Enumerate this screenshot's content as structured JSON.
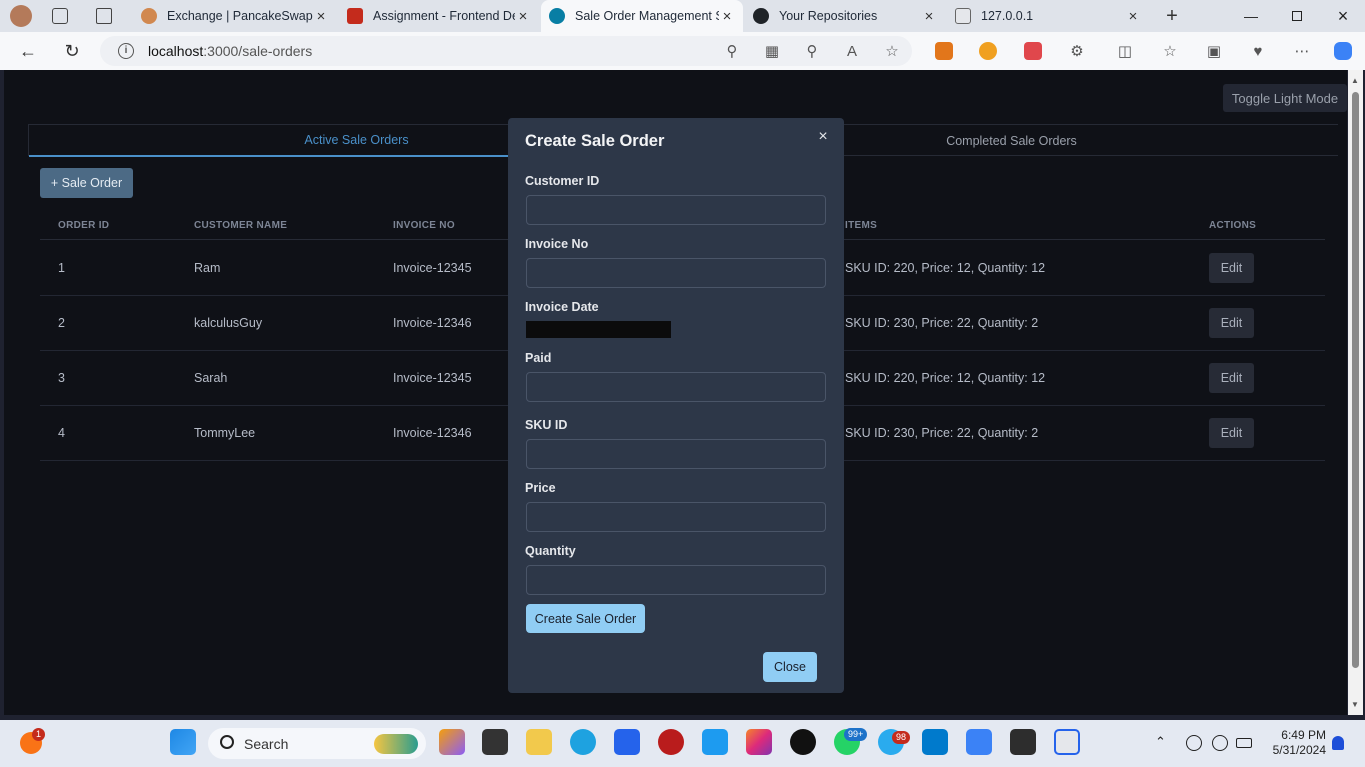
{
  "browser": {
    "tabs": [
      {
        "title": "Exchange | PancakeSwap",
        "icon": "pancakeswap-icon",
        "color": "#d1884f"
      },
      {
        "title": "Assignment - Frontend De",
        "icon": "pdf-icon",
        "color": "#c42b1c"
      },
      {
        "title": "Sale Order Management S",
        "icon": "react-icon",
        "color": "#087ea4"
      },
      {
        "title": "Your Repositories",
        "icon": "github-icon",
        "color": "#1f2328"
      },
      {
        "title": "127.0.0.1",
        "icon": "page-icon",
        "color": "#666666"
      }
    ],
    "url_host": "localhost",
    "url_path": ":3000/sale-orders"
  },
  "page": {
    "toggle_label": "Toggle Light Mode",
    "tabs": [
      "Active Sale Orders",
      "Completed Sale Orders"
    ],
    "add_button": "+ Sale Order",
    "columns": [
      "ORDER ID",
      "CUSTOMER NAME",
      "INVOICE NO",
      "ITEMS",
      "ACTIONS"
    ],
    "rows": [
      {
        "id": "1",
        "name": "Ram",
        "invoice": "Invoice-12345",
        "items": "SKU ID: 220, Price: 12, Quantity: 12",
        "action": "Edit"
      },
      {
        "id": "2",
        "name": "kalculusGuy",
        "invoice": "Invoice-12346",
        "items": "SKU ID: 230, Price: 22, Quantity: 2",
        "action": "Edit"
      },
      {
        "id": "3",
        "name": "Sarah",
        "invoice": "Invoice-12345",
        "items": "SKU ID: 220, Price: 12, Quantity: 12",
        "action": "Edit"
      },
      {
        "id": "4",
        "name": "TommyLee",
        "invoice": "Invoice-12346",
        "items": "SKU ID: 230, Price: 22, Quantity: 2",
        "action": "Edit"
      }
    ]
  },
  "modal": {
    "title": "Create Sale Order",
    "close_x": "×",
    "fields": {
      "customer_id": "Customer ID",
      "invoice_no": "Invoice No",
      "invoice_date": "Invoice Date",
      "paid": "Paid",
      "sku_id": "SKU ID",
      "price": "Price",
      "quantity": "Quantity"
    },
    "values": {
      "customer_id": "",
      "invoice_no": "",
      "paid": "",
      "sku_id": "",
      "price": "",
      "quantity": ""
    },
    "submit": "Create Sale Order",
    "close": "Close"
  },
  "taskbar": {
    "search": "Search",
    "notification_badge": "1",
    "whatsapp_badge": "99+",
    "telegram_badge": "98",
    "time": "6:49 PM",
    "date": "5/31/2024"
  },
  "colors": {
    "accent_tab": "#4a90c9",
    "modal_bg": "#2d3748",
    "primary_button": "#90cdf4",
    "page_bg": "#0f1117"
  }
}
